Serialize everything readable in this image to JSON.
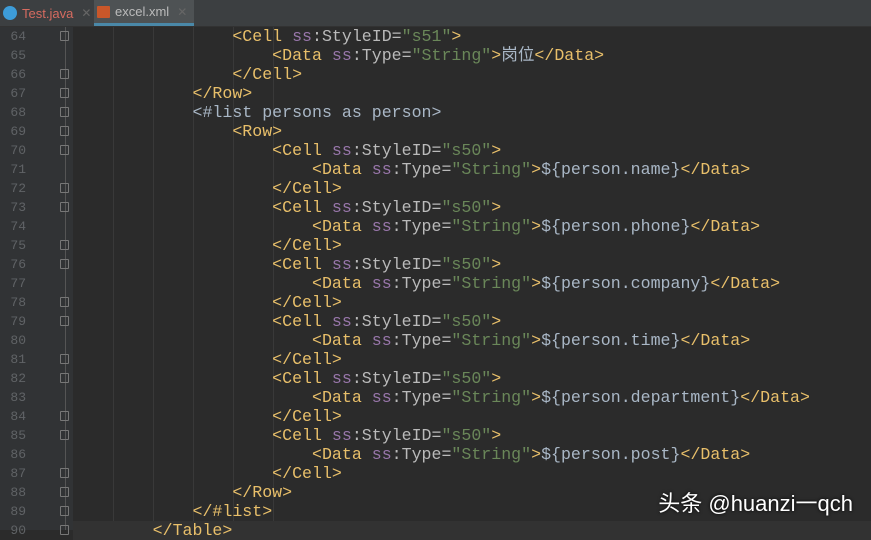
{
  "tabs": [
    {
      "label": "Test.java",
      "icon": "java-class-icon"
    },
    {
      "label": "excel.xml",
      "icon": "xml-file-icon",
      "active": true
    }
  ],
  "watermark": "头条 @huanzi一qch",
  "lines": [
    {
      "n": "64",
      "i": 16,
      "k": [
        [
          "tag",
          "<Cell "
        ],
        [
          "an",
          "ss"
        ],
        [
          "at",
          ":StyleID="
        ],
        [
          "av",
          "\"s51\""
        ],
        [
          "tag",
          ">"
        ]
      ]
    },
    {
      "n": "65",
      "i": 20,
      "k": [
        [
          "tag",
          "<Data "
        ],
        [
          "an",
          "ss"
        ],
        [
          "at",
          ":Type="
        ],
        [
          "av",
          "\"String\""
        ],
        [
          "tag",
          ">"
        ],
        [
          "tx",
          "岗位"
        ],
        [
          "tag",
          "</Data>"
        ]
      ]
    },
    {
      "n": "66",
      "i": 16,
      "k": [
        [
          "tag",
          "</Cell>"
        ]
      ]
    },
    {
      "n": "67",
      "i": 12,
      "k": [
        [
          "tag",
          "</Row>"
        ]
      ]
    },
    {
      "n": "68",
      "i": 12,
      "k": [
        [
          "tx",
          "<#list persons as person>"
        ]
      ]
    },
    {
      "n": "69",
      "i": 16,
      "k": [
        [
          "tag",
          "<Row>"
        ]
      ]
    },
    {
      "n": "70",
      "i": 20,
      "k": [
        [
          "tag",
          "<Cell "
        ],
        [
          "an",
          "ss"
        ],
        [
          "at",
          ":StyleID="
        ],
        [
          "av",
          "\"s50\""
        ],
        [
          "tag",
          ">"
        ]
      ]
    },
    {
      "n": "71",
      "i": 24,
      "k": [
        [
          "tag",
          "<Data "
        ],
        [
          "an",
          "ss"
        ],
        [
          "at",
          ":Type="
        ],
        [
          "av",
          "\"String\""
        ],
        [
          "tag",
          ">"
        ],
        [
          "tx",
          "${person.name}"
        ],
        [
          "tag",
          "</Data>"
        ]
      ]
    },
    {
      "n": "72",
      "i": 20,
      "k": [
        [
          "tag",
          "</Cell>"
        ]
      ]
    },
    {
      "n": "73",
      "i": 20,
      "k": [
        [
          "tag",
          "<Cell "
        ],
        [
          "an",
          "ss"
        ],
        [
          "at",
          ":StyleID="
        ],
        [
          "av",
          "\"s50\""
        ],
        [
          "tag",
          ">"
        ]
      ]
    },
    {
      "n": "74",
      "i": 24,
      "k": [
        [
          "tag",
          "<Data "
        ],
        [
          "an",
          "ss"
        ],
        [
          "at",
          ":Type="
        ],
        [
          "av",
          "\"String\""
        ],
        [
          "tag",
          ">"
        ],
        [
          "tx",
          "${person.phone}"
        ],
        [
          "tag",
          "</Data>"
        ]
      ]
    },
    {
      "n": "75",
      "i": 20,
      "k": [
        [
          "tag",
          "</Cell>"
        ]
      ]
    },
    {
      "n": "76",
      "i": 20,
      "k": [
        [
          "tag",
          "<Cell "
        ],
        [
          "an",
          "ss"
        ],
        [
          "at",
          ":StyleID="
        ],
        [
          "av",
          "\"s50\""
        ],
        [
          "tag",
          ">"
        ]
      ]
    },
    {
      "n": "77",
      "i": 24,
      "k": [
        [
          "tag",
          "<Data "
        ],
        [
          "an",
          "ss"
        ],
        [
          "at",
          ":Type="
        ],
        [
          "av",
          "\"String\""
        ],
        [
          "tag",
          ">"
        ],
        [
          "tx",
          "${person.company}"
        ],
        [
          "tag",
          "</Data>"
        ]
      ]
    },
    {
      "n": "78",
      "i": 20,
      "k": [
        [
          "tag",
          "</Cell>"
        ]
      ]
    },
    {
      "n": "79",
      "i": 20,
      "k": [
        [
          "tag",
          "<Cell "
        ],
        [
          "an",
          "ss"
        ],
        [
          "at",
          ":StyleID="
        ],
        [
          "av",
          "\"s50\""
        ],
        [
          "tag",
          ">"
        ]
      ]
    },
    {
      "n": "80",
      "i": 24,
      "k": [
        [
          "tag",
          "<Data "
        ],
        [
          "an",
          "ss"
        ],
        [
          "at",
          ":Type="
        ],
        [
          "av",
          "\"String\""
        ],
        [
          "tag",
          ">"
        ],
        [
          "tx",
          "${person.time}"
        ],
        [
          "tag",
          "</Data>"
        ]
      ]
    },
    {
      "n": "81",
      "i": 20,
      "k": [
        [
          "tag",
          "</Cell>"
        ]
      ]
    },
    {
      "n": "82",
      "i": 20,
      "k": [
        [
          "tag",
          "<Cell "
        ],
        [
          "an",
          "ss"
        ],
        [
          "at",
          ":StyleID="
        ],
        [
          "av",
          "\"s50\""
        ],
        [
          "tag",
          ">"
        ]
      ]
    },
    {
      "n": "83",
      "i": 24,
      "k": [
        [
          "tag",
          "<Data "
        ],
        [
          "an",
          "ss"
        ],
        [
          "at",
          ":Type="
        ],
        [
          "av",
          "\"String\""
        ],
        [
          "tag",
          ">"
        ],
        [
          "tx",
          "${person.department}"
        ],
        [
          "tag",
          "</Data>"
        ]
      ]
    },
    {
      "n": "84",
      "i": 20,
      "k": [
        [
          "tag",
          "</Cell>"
        ]
      ]
    },
    {
      "n": "85",
      "i": 20,
      "k": [
        [
          "tag",
          "<Cell "
        ],
        [
          "an",
          "ss"
        ],
        [
          "at",
          ":StyleID="
        ],
        [
          "av",
          "\"s50\""
        ],
        [
          "tag",
          ">"
        ]
      ]
    },
    {
      "n": "86",
      "i": 24,
      "k": [
        [
          "tag",
          "<Data "
        ],
        [
          "an",
          "ss"
        ],
        [
          "at",
          ":Type="
        ],
        [
          "av",
          "\"String\""
        ],
        [
          "tag",
          ">"
        ],
        [
          "tx",
          "${person.post}"
        ],
        [
          "tag",
          "</Data>"
        ]
      ]
    },
    {
      "n": "87",
      "i": 20,
      "k": [
        [
          "tag",
          "</Cell>"
        ]
      ]
    },
    {
      "n": "88",
      "i": 16,
      "k": [
        [
          "tag",
          "</Row>"
        ]
      ]
    },
    {
      "n": "89",
      "i": 12,
      "k": [
        [
          "tag",
          "</#list>"
        ]
      ]
    },
    {
      "n": "90",
      "i": 8,
      "k": [
        [
          "tag",
          "</Table>"
        ]
      ],
      "current": true
    }
  ]
}
